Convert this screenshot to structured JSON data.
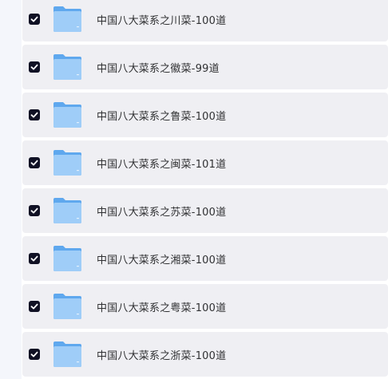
{
  "items": [
    {
      "label": "中国八大菜系之川菜-100道",
      "checked": true,
      "icon": "folder-icon"
    },
    {
      "label": "中国八大菜系之徽菜-99道",
      "checked": true,
      "icon": "folder-icon"
    },
    {
      "label": "中国八大菜系之鲁菜-100道",
      "checked": true,
      "icon": "folder-icon"
    },
    {
      "label": "中国八大菜系之闽菜-101道",
      "checked": true,
      "icon": "folder-icon"
    },
    {
      "label": "中国八大菜系之苏菜-100道",
      "checked": true,
      "icon": "folder-icon"
    },
    {
      "label": "中国八大菜系之湘菜-100道",
      "checked": true,
      "icon": "folder-icon"
    },
    {
      "label": "中国八大菜系之粤菜-100道",
      "checked": true,
      "icon": "folder-icon"
    },
    {
      "label": "中国八大菜系之浙菜-100道",
      "checked": true,
      "icon": "folder-icon"
    }
  ],
  "colors": {
    "row_background": "#efeff3",
    "checkbox": "#101124",
    "folder_back": "#5fa8ee",
    "folder_front": "#9fcdf8",
    "text": "#303133"
  }
}
